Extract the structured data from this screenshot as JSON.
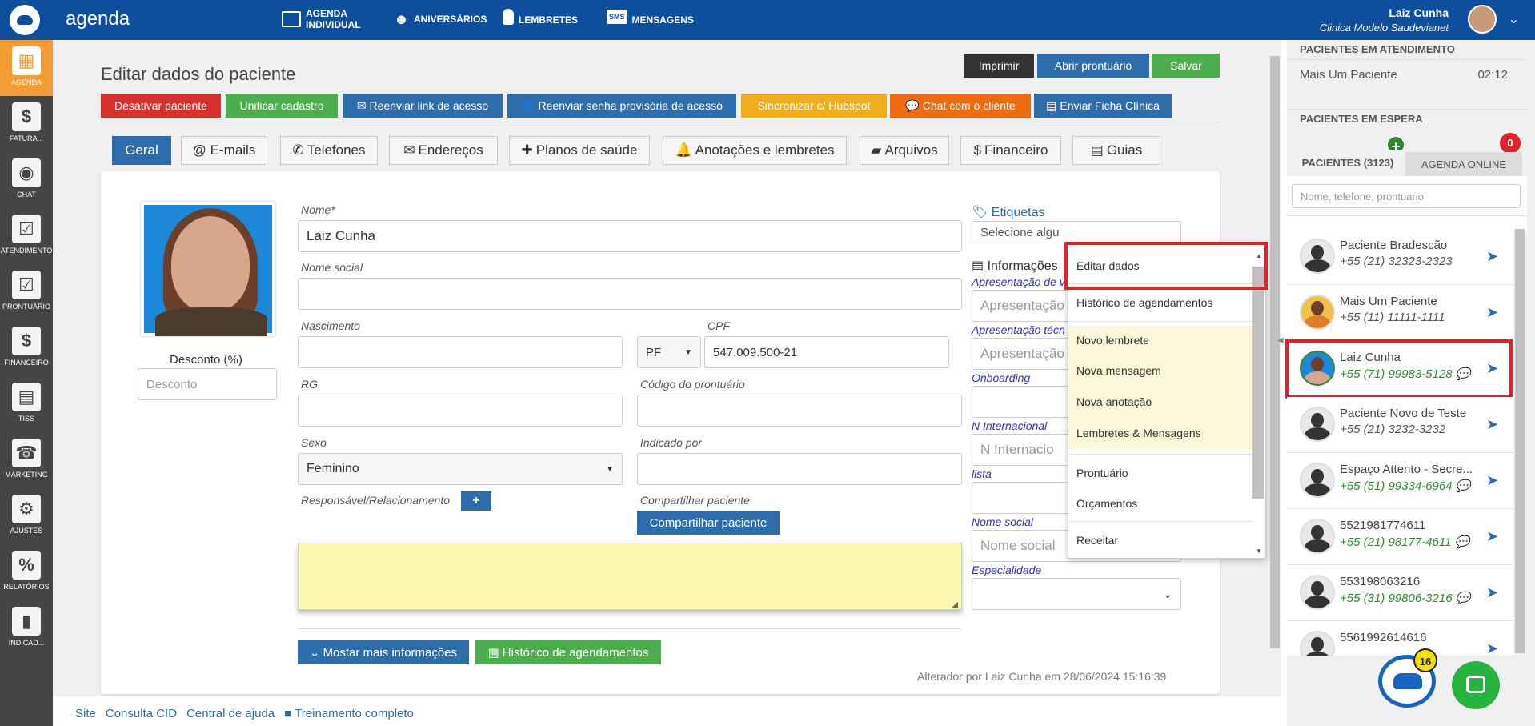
{
  "app": {
    "brand": "agenda"
  },
  "topnav": [
    {
      "label": "AGENDA INDIVIDUAL",
      "icon": "calendar-icon"
    },
    {
      "label": "ANIVERSÁRIOS",
      "icon": "people-icon"
    },
    {
      "label": "LEMBRETES",
      "icon": "lightbulb-icon"
    },
    {
      "label": "MENSAGENS",
      "icon": "sms-icon"
    }
  ],
  "user": {
    "name": "Laiz Cunha",
    "clinic": "Clinica Modelo Saudevianet"
  },
  "sidebar": [
    {
      "label": "AGENDA",
      "glyph": "▦"
    },
    {
      "label": "FATURA...",
      "glyph": "$"
    },
    {
      "label": "CHAT",
      "glyph": "◉"
    },
    {
      "label": "ATENDIMENTO",
      "glyph": "☑"
    },
    {
      "label": "PRONTUÁRIO",
      "glyph": "☑"
    },
    {
      "label": "FINANCEIRO",
      "glyph": "$"
    },
    {
      "label": "TISS",
      "glyph": "▤"
    },
    {
      "label": "MARKETING",
      "glyph": "☎"
    },
    {
      "label": "AJUSTES",
      "glyph": "⚙"
    },
    {
      "label": "RELATÓRIOS",
      "glyph": "%"
    },
    {
      "label": "INDICAD...",
      "glyph": "▮"
    }
  ],
  "page": {
    "title": "Editar dados do paciente",
    "top_actions": {
      "print": "Imprimir",
      "open_record": "Abrir prontuário",
      "save": "Salvar"
    },
    "actions": {
      "deactivate": "Desativar paciente",
      "merge": "Unificar cadastro",
      "resend_link": "Reenviar link de acesso",
      "resend_password": "Reenviar senha provisória de acesso",
      "hubspot": "Sincronizar c/ Hubspot",
      "chat": "Chat com o cliente",
      "send_form": "Enviar Ficha Clínica"
    },
    "tabs": [
      "Geral",
      "@ E-mails",
      "Telefones",
      "Endereços",
      "Planos de saúde",
      "Anotações e lembretes",
      "Arquivos",
      "Financeiro",
      "Guias"
    ]
  },
  "form": {
    "name_label": "Nome*",
    "name_value": "Laiz Cunha",
    "social_name_label": "Nome social",
    "birth_label": "Nascimento",
    "cpf_label": "CPF",
    "cpf_type": "PF",
    "cpf_value": "547.009.500-21",
    "rg_label": "RG",
    "record_code_label": "Código do prontuário",
    "sex_label": "Sexo",
    "sex_value": "Feminino",
    "referred_label": "Indicado por",
    "responsible_label": "Responsável/Relacionamento",
    "add_glyph": "+",
    "share_label": "Compartilhar paciente",
    "share_button": "Compartilhar paciente",
    "discount_label": "Desconto (%)",
    "discount_placeholder": "Desconto",
    "tags_label": "Etiquetas",
    "tags_placeholder": "Selecione algu",
    "info_label": "Informações",
    "presentation_label": "Apresentação de v",
    "presentation_placeholder": "Apresentação",
    "tech_presentation_label": "Apresentação técn",
    "tech_presentation_placeholder": "Apresentação",
    "onboarding_label": "Onboarding",
    "intl_label": "N Internacional",
    "intl_placeholder": "N Internacio",
    "lista_label": "lista",
    "social_name2_label": "Nome social",
    "social_name2_placeholder": "Nome social",
    "specialty_label": "Especialidade",
    "more_info_button": "Mostar mais informações",
    "history_button": "Histórico de agendamentos",
    "altered_by": "Alterador por Laiz Cunha em 28/06/2024 15:16:39"
  },
  "context_menu": [
    {
      "label": "Editar dados",
      "highlight": false
    },
    {
      "label": "Histórico de agendamentos",
      "highlight": false
    },
    {
      "label": "Novo lembrete",
      "highlight": true
    },
    {
      "label": "Nova mensagem",
      "highlight": true
    },
    {
      "label": "Nova anotação",
      "highlight": true
    },
    {
      "label": "Lembretes & Mensagens",
      "highlight": true
    },
    {
      "label": "Prontuário",
      "highlight": false
    },
    {
      "label": "Orçamentos",
      "highlight": false
    },
    {
      "label": "Receitar",
      "highlight": false
    }
  ],
  "footer": [
    "Site",
    "Consulta CID",
    "Central de ajuda",
    "Treinamento completo"
  ],
  "right_panel": {
    "in_service_title": "PACIENTES EM ATENDIMENTO",
    "in_service": {
      "name": "Mais Um Paciente",
      "time": "02:12"
    },
    "waiting_title": "PACIENTES EM ESPERA",
    "tab_patients": "PACIENTES (3123)",
    "tab_online": "AGENDA ONLINE",
    "online_badge": "0",
    "search_placeholder": "Nome, telefone, prontuario",
    "patients": [
      {
        "name": "Paciente Bradescão",
        "phone": "+55 (21) 32323-2323",
        "green": false
      },
      {
        "name": "Mais Um Paciente",
        "phone": "+55 (11) 11111-1111",
        "green": false
      },
      {
        "name": "Laiz Cunha",
        "phone": "+55 (71) 99983-5128",
        "green": true
      },
      {
        "name": "Paciente Novo de Teste",
        "phone": "+55 (21) 3232-3232",
        "green": false
      },
      {
        "name": "Espaço Attento - Secre...",
        "phone": "+55 (51) 99334-6964",
        "green": true
      },
      {
        "name": "5521981774611",
        "phone": "+55 (21) 98177-4611",
        "green": true
      },
      {
        "name": "553198063216",
        "phone": "+55 (31) 99806-3216",
        "green": true
      },
      {
        "name": "5561992614616",
        "phone": "",
        "green": false
      }
    ],
    "chat_badge": "16"
  },
  "colors": {
    "topbar": "#0d4f9e",
    "primary": "#2e6dab",
    "danger": "#d9302c",
    "success": "#4cae4c",
    "warning": "#f0ad1c",
    "orange": "#f06a0f",
    "highlight_box": "#e0222a"
  }
}
